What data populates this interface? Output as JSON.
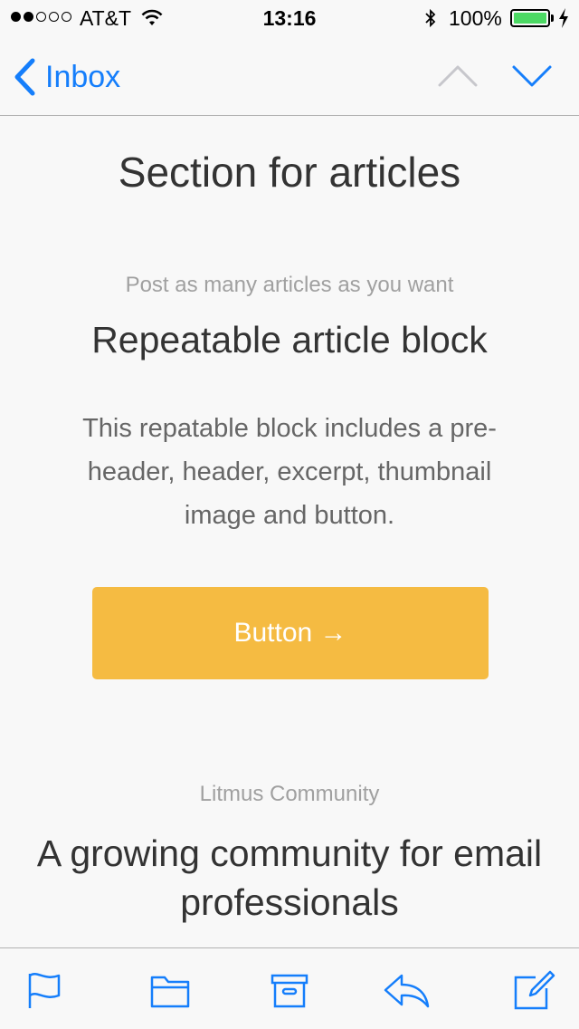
{
  "status_bar": {
    "carrier": "AT&T",
    "time": "13:16",
    "battery_percent": "100%",
    "signal_bars_filled": 2,
    "signal_bars_total": 5,
    "battery_color": "#4cd964"
  },
  "nav": {
    "back_label": "Inbox",
    "accent_color": "#157efb",
    "icons": [
      "chevron-left-icon",
      "chevron-up-icon",
      "chevron-down-icon"
    ]
  },
  "email": {
    "section_title": "Section for articles",
    "article": {
      "preheader": "Post as many articles as you want",
      "header": "Repeatable article block",
      "excerpt": "This repatable block includes a pre-header, header, excerpt, thumbnail image and button.",
      "button_label": "Button →",
      "button_color": "#f5bb42"
    },
    "community": {
      "preheader": "Litmus Community",
      "header": "A growing community for email professionals"
    }
  },
  "toolbar": {
    "icons": [
      "flag-icon",
      "folder-icon",
      "archive-icon",
      "reply-icon",
      "compose-icon"
    ]
  }
}
